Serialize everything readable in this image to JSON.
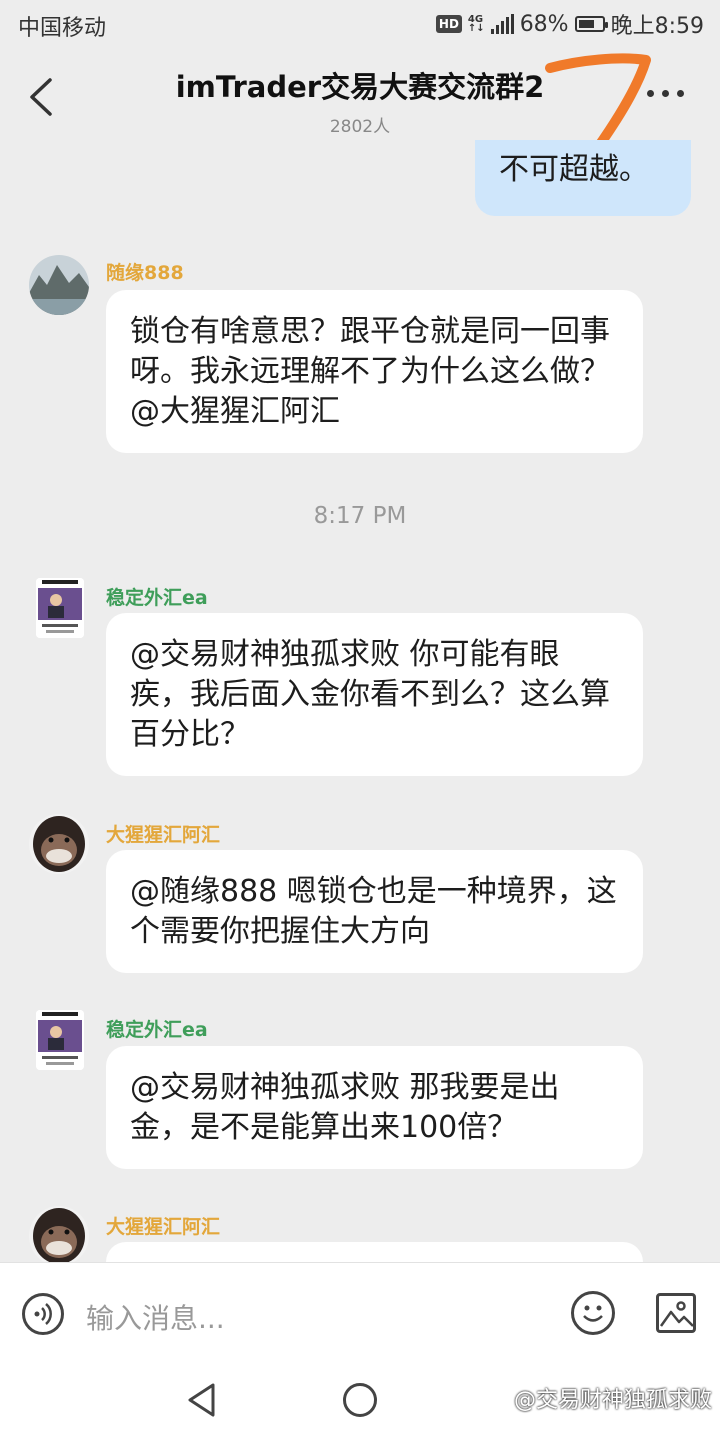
{
  "status_bar": {
    "carrier": "中国移动",
    "hd": "HD",
    "network": "4G",
    "battery_percent": "68%",
    "battery_level": 0.68,
    "time": "晚上8:59"
  },
  "header": {
    "title": "imTrader交易大赛交流群2",
    "member_count": "2802人"
  },
  "messages": [
    {
      "sender": "",
      "text": "不可超越。",
      "self": true
    },
    {
      "sender": "随缘888",
      "text": "锁仓有啥意思？跟平仓就是同一回事呀。我永远理解不了为什么这么做？@大猩猩汇阿汇"
    },
    {
      "sender": "稳定外汇ea",
      "text": "@交易财神独孤求败 你可能有眼疾，我后面入金你看不到么？这么算百分比？"
    },
    {
      "sender": "大猩猩汇阿汇",
      "text": "@随缘888 嗯锁仓也是一种境界，这个需要你把握住大方向"
    },
    {
      "sender": "稳定外汇ea",
      "text": "@交易财神独孤求败 那我要是出金，是不是能算出来100倍？"
    },
    {
      "sender": "大猩猩汇阿汇",
      "text": ""
    }
  ],
  "time_divider": "8:17 PM",
  "input": {
    "placeholder": "输入消息..."
  },
  "watermark": "@交易财神独孤求败",
  "colors": {
    "sender_yellow": "#e3a73b",
    "sender_green": "#3f9e5a",
    "self_bubble": "#cfe6fb",
    "annotation_orange": "#f07a2a"
  }
}
